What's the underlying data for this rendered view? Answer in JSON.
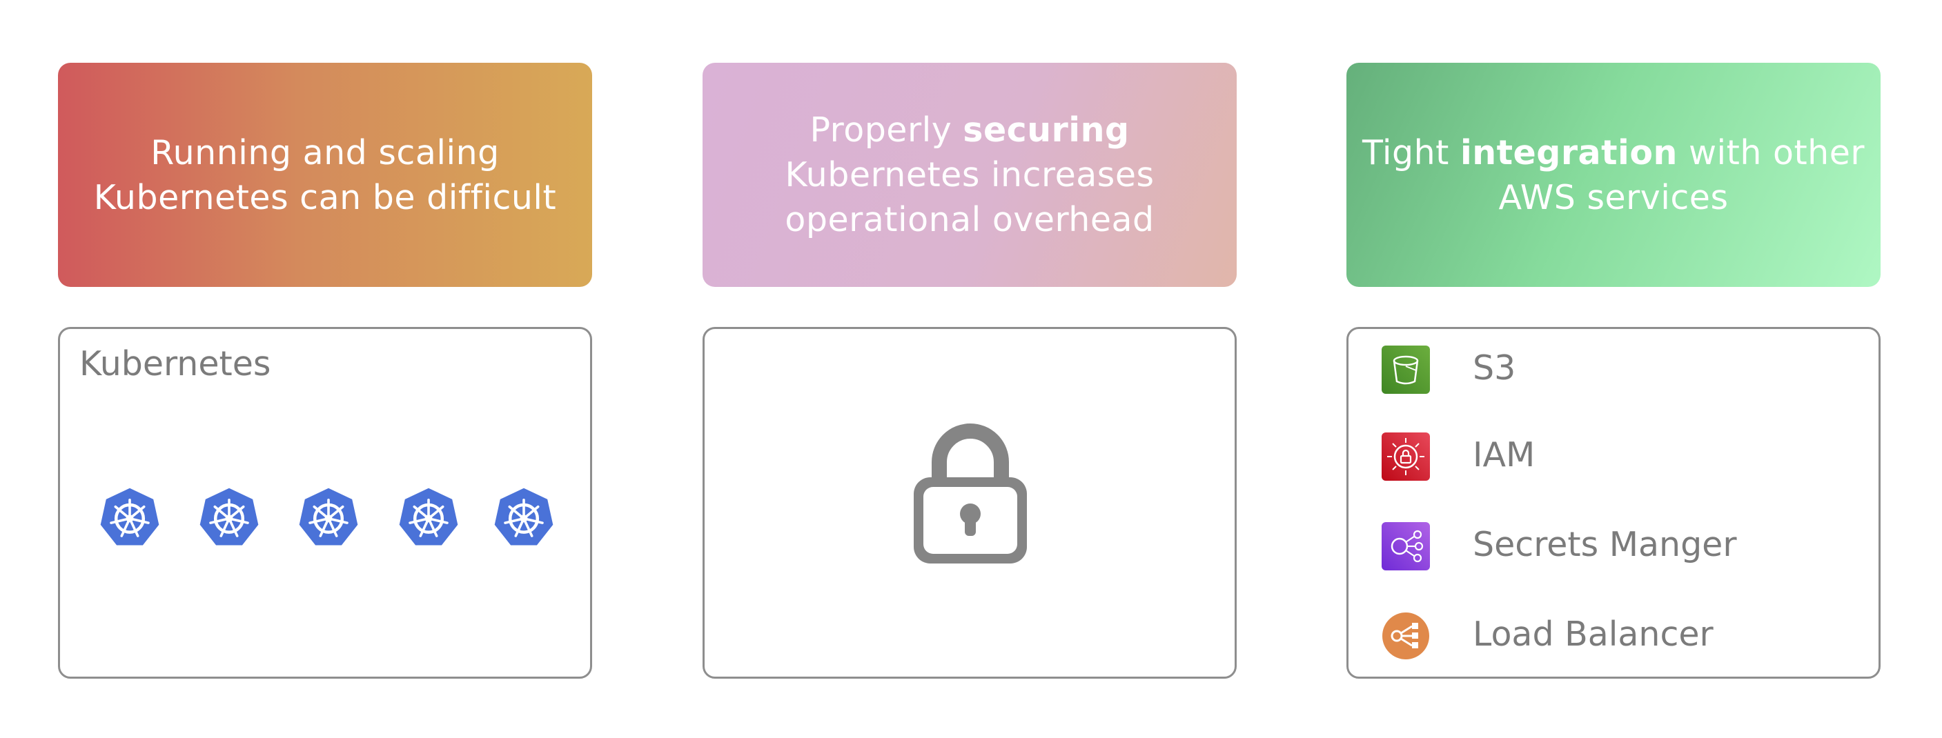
{
  "banners": [
    {
      "lines": [
        "Running and scaling",
        "Kubernetes can be difficult"
      ]
    },
    {
      "line1_pre": "Properly ",
      "line1_bold": "securing",
      "line2": "Kubernetes increases",
      "line3": "operational overhead"
    },
    {
      "line1_pre": "Tight ",
      "line1_bold": "integration",
      "line1_post": " with other",
      "line2": "AWS services"
    }
  ],
  "kubernetes_box": {
    "title": "Kubernetes",
    "icons": [
      "kubernetes-icon",
      "kubernetes-icon",
      "kubernetes-icon",
      "kubernetes-icon",
      "kubernetes-icon"
    ]
  },
  "security_box": {
    "icon": "lock-icon"
  },
  "aws_services": [
    {
      "label": "S3",
      "icon": "s3-bucket-icon",
      "color": "#5aa33b"
    },
    {
      "label": "IAM",
      "icon": "iam-icon",
      "color": "#d13a45"
    },
    {
      "label": "Secrets Manger",
      "icon": "secrets-manager-icon",
      "color": "#8a4ad8"
    },
    {
      "label": "Load Balancer",
      "icon": "load-balancer-icon",
      "color": "#e0894a"
    }
  ],
  "colors": {
    "kubernetes_blue": "#4a72d8",
    "lock_gray": "#858585",
    "border_gray": "#8e8e8e",
    "text_gray": "#7b7b7b"
  }
}
